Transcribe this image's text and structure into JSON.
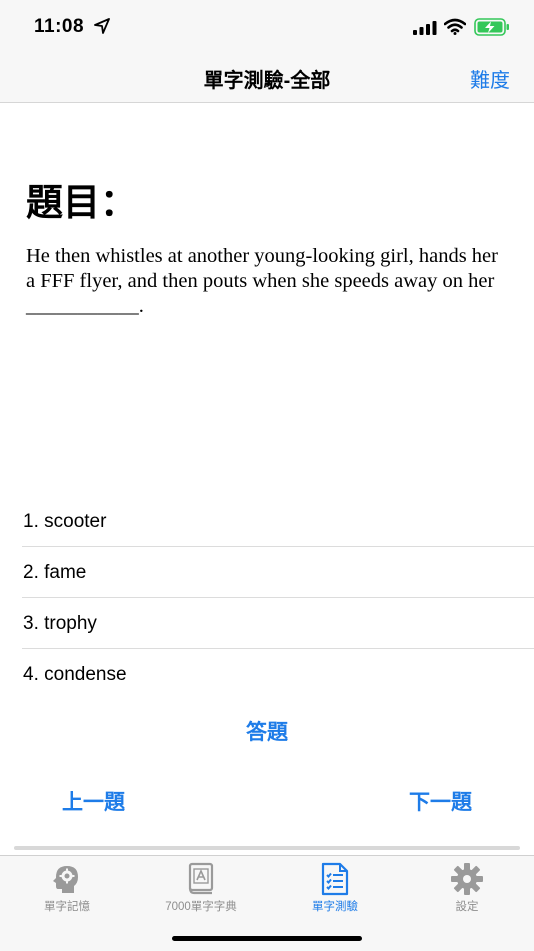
{
  "status_bar": {
    "time": "11:08",
    "icons": [
      "location-arrow-icon",
      "signal-icon",
      "wifi-icon",
      "battery-charging-icon"
    ]
  },
  "nav": {
    "title": "單字測驗-全部",
    "right_button": "難度"
  },
  "question": {
    "heading": "題目：",
    "text": "He then whistles at another young-looking girl, hands her a FFF flyer, and then pouts when she speeds away on her ___________."
  },
  "options": [
    {
      "label": "1. scooter"
    },
    {
      "label": "2. fame"
    },
    {
      "label": "3. trophy"
    },
    {
      "label": "4. condense"
    }
  ],
  "actions": {
    "answer": "答題",
    "prev": "上一題",
    "next": "下一題"
  },
  "tabs": [
    {
      "label": "單字記憶",
      "icon": "head-gear-icon",
      "active": false
    },
    {
      "label": "7000單字字典",
      "icon": "dictionary-book-icon",
      "active": false
    },
    {
      "label": "單字測驗",
      "icon": "quiz-checklist-icon",
      "active": true
    },
    {
      "label": "設定",
      "icon": "gear-icon",
      "active": false
    }
  ],
  "colors": {
    "accent": "#1e7ce8",
    "inactive_tab": "#8e8e8e",
    "bar_background": "#f7f7f7",
    "battery_green": "#34c759"
  }
}
